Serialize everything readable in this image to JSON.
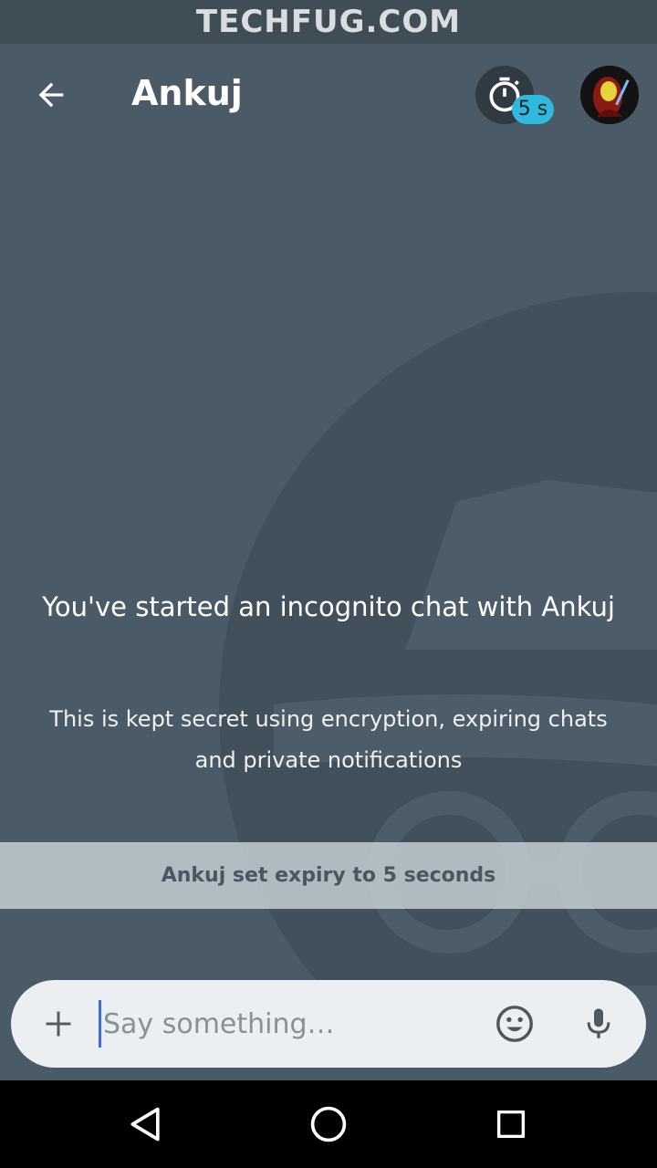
{
  "watermark": {
    "text": "TECHFUG.COM"
  },
  "header": {
    "title": "Ankuj",
    "timer_badge": "5 s",
    "back_icon": "arrow-left-icon",
    "timer_icon": "stopwatch-icon",
    "avatar_icon": "avatar"
  },
  "intro": {
    "title": "You've started an incognito chat with Ankuj",
    "subtitle": "This is kept secret using encryption, expiring chats and private notifications"
  },
  "system_message": {
    "text": "Ankuj set expiry to 5 seconds"
  },
  "composer": {
    "placeholder": "Say something…",
    "add_icon": "plus-icon",
    "emoji_icon": "emoji-icon",
    "mic_icon": "microphone-icon"
  },
  "navigation": {
    "back_icon": "triangle-back-icon",
    "home_icon": "circle-home-icon",
    "recents_icon": "square-recents-icon"
  },
  "colors": {
    "background": "#4a5a66",
    "accent_badge": "#2fb9e0",
    "composer_bg": "#ebeff1"
  }
}
